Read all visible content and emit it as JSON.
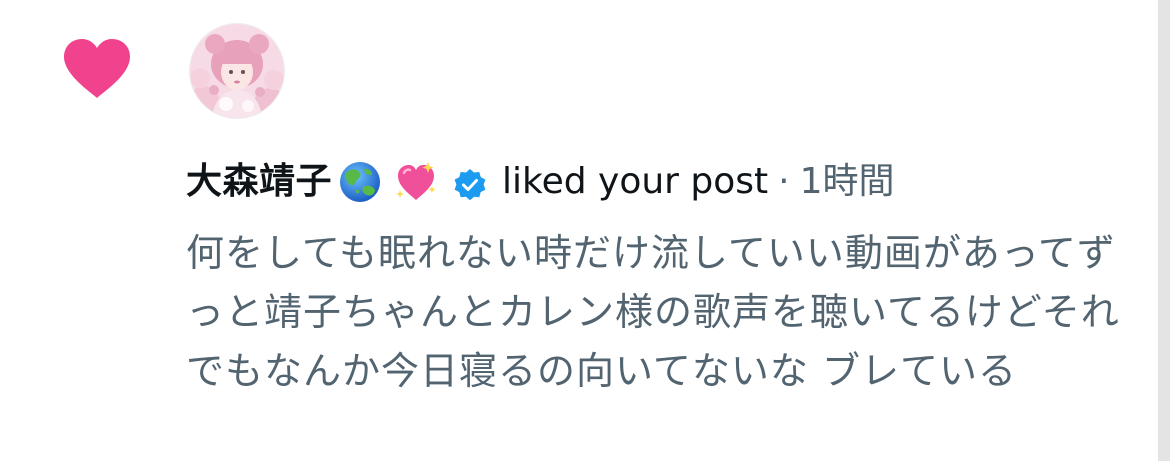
{
  "notification": {
    "type_icon": "heart-icon",
    "type_color": "#f0428d",
    "author": {
      "name": "大森靖子",
      "emojis": [
        "globe-asia-australia-emoji",
        "sparkling-heart-emoji"
      ],
      "verified_icon": "verified-badge-icon",
      "verified_color": "#1d9bf0"
    },
    "action_text": "liked your post",
    "separator": "·",
    "time": "1時間",
    "post_text": "何をしても眠れない時だけ流していい動画があってずっと靖子ちゃんとカレン様の歌声を聴いてるけどそれでもなんか今日寝るの向いてないな ブレている"
  }
}
